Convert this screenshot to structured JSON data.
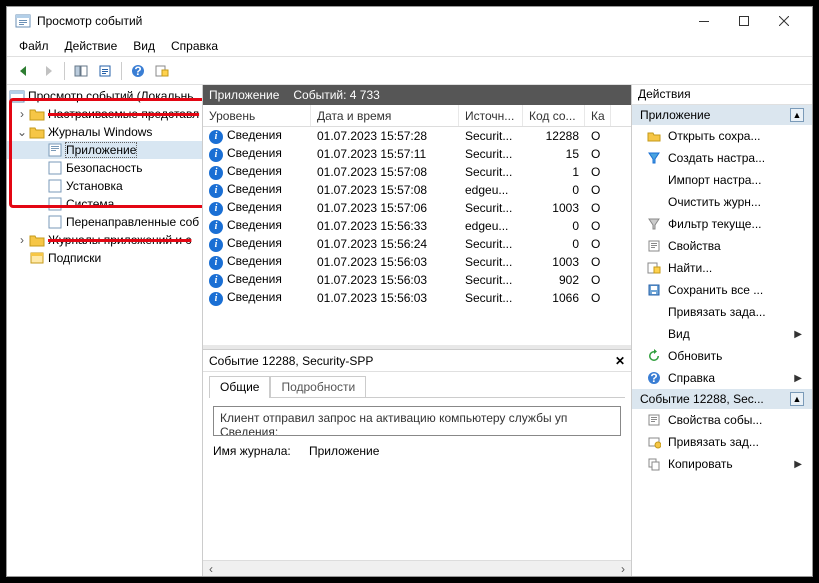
{
  "window": {
    "title": "Просмотр событий"
  },
  "menus": {
    "file": "Файл",
    "action": "Действие",
    "view": "Вид",
    "help": "Справка"
  },
  "tree": {
    "root": "Просмотр событий (Локальнь",
    "custom": "Настраиваемые представл",
    "winlogs": "Журналы Windows",
    "app": "Приложение",
    "security": "Безопасность",
    "setup": "Установка",
    "system": "Система",
    "forwarded": "Перенаправленные соб",
    "appsvc": "Журналы приложений и с",
    "subs": "Подписки"
  },
  "centerHeader": {
    "title": "Приложение",
    "eventsLabel": "Событий: 4 733"
  },
  "columns": {
    "level": "Уровень",
    "datetime": "Дата и время",
    "source": "Источн...",
    "code": "Код со...",
    "cat": "Ка"
  },
  "rows": [
    {
      "level": "Сведения",
      "dt": "01.07.2023 15:57:28",
      "src": "Securit...",
      "code": "12288",
      "cat": "О"
    },
    {
      "level": "Сведения",
      "dt": "01.07.2023 15:57:11",
      "src": "Securit...",
      "code": "15",
      "cat": "О"
    },
    {
      "level": "Сведения",
      "dt": "01.07.2023 15:57:08",
      "src": "Securit...",
      "code": "1",
      "cat": "О"
    },
    {
      "level": "Сведения",
      "dt": "01.07.2023 15:57:08",
      "src": "edgeu...",
      "code": "0",
      "cat": "О"
    },
    {
      "level": "Сведения",
      "dt": "01.07.2023 15:57:06",
      "src": "Securit...",
      "code": "1003",
      "cat": "О"
    },
    {
      "level": "Сведения",
      "dt": "01.07.2023 15:56:33",
      "src": "edgeu...",
      "code": "0",
      "cat": "О"
    },
    {
      "level": "Сведения",
      "dt": "01.07.2023 15:56:24",
      "src": "Securit...",
      "code": "0",
      "cat": "О"
    },
    {
      "level": "Сведения",
      "dt": "01.07.2023 15:56:03",
      "src": "Securit...",
      "code": "1003",
      "cat": "О"
    },
    {
      "level": "Сведения",
      "dt": "01.07.2023 15:56:03",
      "src": "Securit...",
      "code": "902",
      "cat": "О"
    },
    {
      "level": "Сведения",
      "dt": "01.07.2023 15:56:03",
      "src": "Securit...",
      "code": "1066",
      "cat": "О"
    }
  ],
  "detail": {
    "header": "Событие 12288, Security-SPP",
    "tabs": {
      "general": "Общие",
      "details": "Подробности"
    },
    "message": "Клиент отправил запрос на активацию компьютеру службы уп\nСведения:",
    "logNameLabel": "Имя журнала:",
    "logNameValue": "Приложение"
  },
  "actions": {
    "header": "Действия",
    "group1": "Приложение",
    "items1": [
      {
        "icon": "open",
        "label": "Открыть сохра..."
      },
      {
        "icon": "filter",
        "label": "Создать настра..."
      },
      {
        "icon": "none",
        "label": "Импорт настра..."
      },
      {
        "icon": "none",
        "label": "Очистить журн..."
      },
      {
        "icon": "filter2",
        "label": "Фильтр текуще..."
      },
      {
        "icon": "props",
        "label": "Свойства"
      },
      {
        "icon": "find",
        "label": "Найти..."
      },
      {
        "icon": "save",
        "label": "Сохранить все ..."
      },
      {
        "icon": "none",
        "label": "Привязать зада..."
      },
      {
        "icon": "none",
        "label": "Вид",
        "hasSub": true
      },
      {
        "icon": "refresh",
        "label": "Обновить"
      },
      {
        "icon": "help",
        "label": "Справка",
        "hasSub": true
      }
    ],
    "group2": "Событие 12288, Sec...",
    "items2": [
      {
        "icon": "props",
        "label": "Свойства собы..."
      },
      {
        "icon": "attach",
        "label": "Привязать зад..."
      },
      {
        "icon": "copy",
        "label": "Копировать",
        "hasSub": true
      }
    ]
  }
}
